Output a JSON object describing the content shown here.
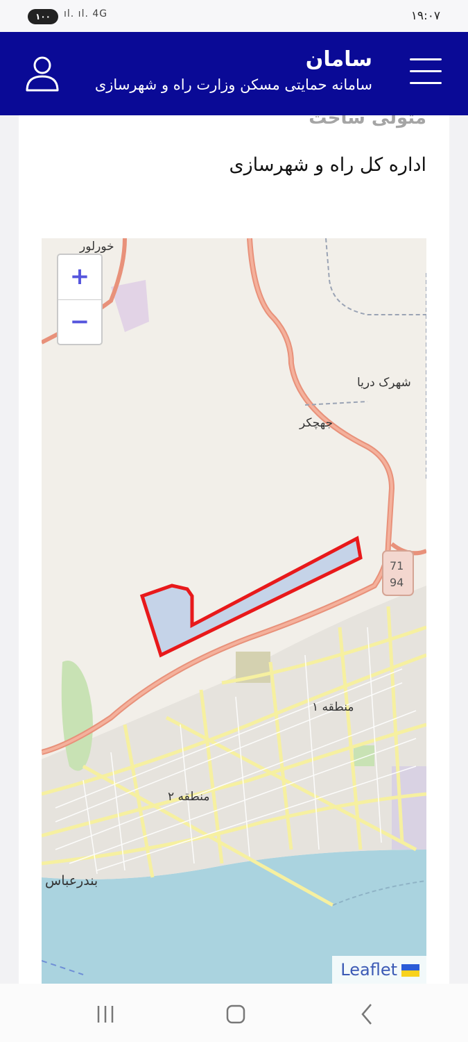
{
  "status_bar": {
    "time": "۱۹:۰۷",
    "battery": "۱۰۰",
    "network": "4G"
  },
  "header": {
    "title": "سامان",
    "subtitle": "سامانه حمایتی مسکن وزارت راه و شهرسازی"
  },
  "details": {
    "builder_label": "متولی ساخت",
    "builder_value": "اداره کل راه و شهرسازی"
  },
  "map": {
    "zoom_in": "+",
    "zoom_out": "−",
    "attribution": "Leaflet",
    "labels": {
      "khorlor": "خورلور",
      "shahrak_darya": "شهرک دریا",
      "jahchekar": "جهچکر",
      "mantaqe1": "منطقه ۱",
      "mantaqe2": "منطقه ۲",
      "bandar_abbas": "بندرعباس",
      "road_71": "71",
      "road_94": "94"
    },
    "colors": {
      "parcel_stroke": "#e8191b",
      "parcel_fill": "#c5d3e8",
      "sea": "#aad3df",
      "land": "#f2efe9"
    }
  }
}
